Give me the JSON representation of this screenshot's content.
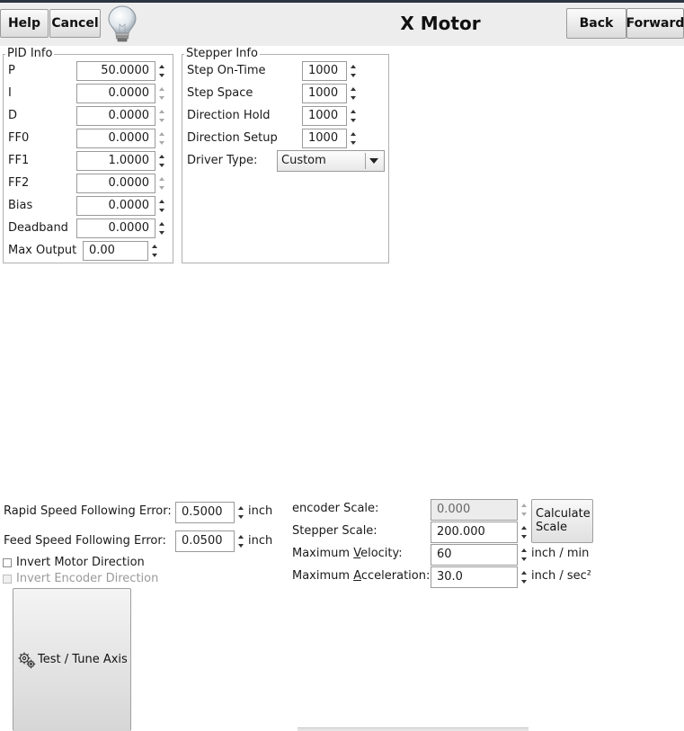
{
  "header": {
    "help_label": "Help",
    "cancel_label": "Cancel",
    "title": "X Motor",
    "back_label": "Back",
    "forward_label": "Forward"
  },
  "pid": {
    "legend": "PID Info",
    "rows": [
      {
        "label": "P",
        "value": "50.0000"
      },
      {
        "label": "I",
        "value": "0.0000"
      },
      {
        "label": "D",
        "value": "0.0000"
      },
      {
        "label": "FF0",
        "value": "0.0000"
      },
      {
        "label": "FF1",
        "value": "1.0000"
      },
      {
        "label": "FF2",
        "value": "0.0000"
      },
      {
        "label": "Bias",
        "value": "0.0000"
      },
      {
        "label": "Deadband",
        "value": "0.0000"
      }
    ],
    "max_output_label": "Max Output",
    "max_output_value": "0.00"
  },
  "stepper": {
    "legend": "Stepper Info",
    "rows": [
      {
        "label": "Step On-Time",
        "value": "1000"
      },
      {
        "label": "Step Space",
        "value": "1000"
      },
      {
        "label": "Direction Hold",
        "value": "1000"
      },
      {
        "label": "Direction Setup",
        "value": "1000"
      }
    ],
    "driver_label": "Driver Type:",
    "driver_value": "Custom"
  },
  "following": {
    "rapid_label": "Rapid Speed Following Error:",
    "rapid_value": "0.5000",
    "rapid_unit": "inch",
    "feed_label": "Feed Speed Following Error:",
    "feed_value": "0.0500",
    "feed_unit": "inch"
  },
  "checks": {
    "invert_motor": "Invert Motor Direction",
    "invert_encoder": "Invert Encoder Direction"
  },
  "scale": {
    "encoder_label": "encoder Scale:",
    "encoder_value": "0.000",
    "stepper_label": "Stepper Scale:",
    "stepper_value": "200.000",
    "calc_line1": "Calculate",
    "calc_line2": "Scale",
    "vel_pre": "Maximum ",
    "vel_u": "V",
    "vel_post": "elocity:",
    "vel_value": "60",
    "vel_unit": "inch / min",
    "acc_pre": "Maximum ",
    "acc_u": "A",
    "acc_post": "cceleration:",
    "acc_value": "30.0",
    "acc_unit": "inch / sec²"
  },
  "test": {
    "label": "Test / Tune Axis",
    "icon": "gears-icon"
  }
}
